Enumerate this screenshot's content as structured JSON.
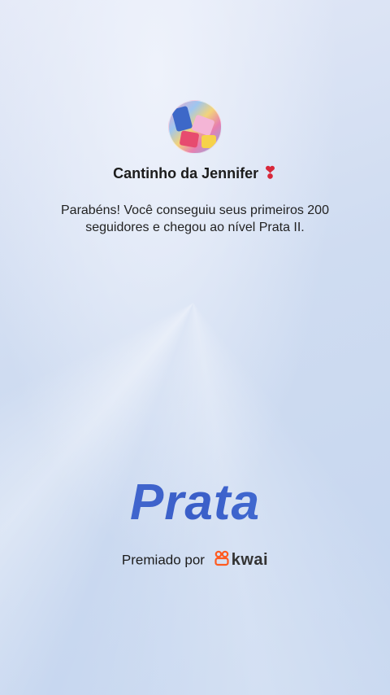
{
  "profile": {
    "name": "Cantinho da Jennifer",
    "name_emoji": "❣"
  },
  "message": "Parabéns! Você conseguiu seus primeiros 200 seguidores e chegou ao nível Prata II.",
  "tier": "Prata",
  "award": {
    "prefix": "Premiado por",
    "brand": "kwai",
    "brand_color": "#ff5a1f"
  }
}
